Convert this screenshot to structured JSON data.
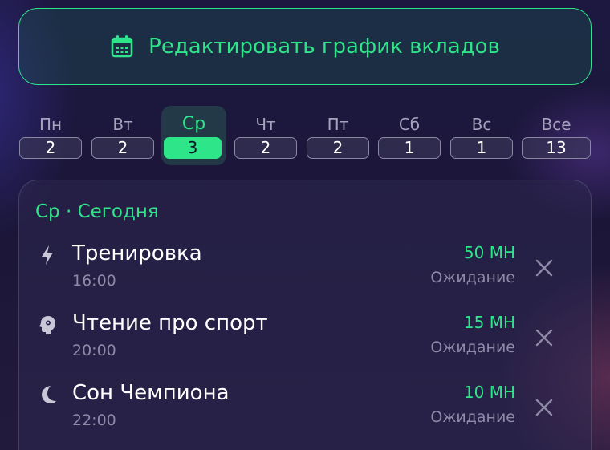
{
  "header": {
    "edit_button_label": "Редактировать график вкладов",
    "edit_button_icon": "calendar-icon"
  },
  "days": [
    {
      "name": "Пн",
      "count": "2",
      "active": false
    },
    {
      "name": "Вт",
      "count": "2",
      "active": false
    },
    {
      "name": "Ср",
      "count": "3",
      "active": true
    },
    {
      "name": "Чт",
      "count": "2",
      "active": false
    },
    {
      "name": "Пт",
      "count": "2",
      "active": false
    },
    {
      "name": "Сб",
      "count": "1",
      "active": false
    },
    {
      "name": "Вс",
      "count": "1",
      "active": false
    },
    {
      "name": "Все",
      "count": "13",
      "active": false
    }
  ],
  "panel": {
    "title": "Ср · Сегодня",
    "items": [
      {
        "name": "Тренировка",
        "time": "16:00",
        "amount": "50 МН",
        "status": "Ожидание",
        "icon": "lightning-icon"
      },
      {
        "name": "Чтение про спорт",
        "time": "20:00",
        "amount": "15 МН",
        "status": "Ожидание",
        "icon": "brain-icon"
      },
      {
        "name": "Сон Чемпиона",
        "time": "22:00",
        "amount": "10 МН",
        "status": "Ожидание",
        "icon": "moon-icon"
      }
    ]
  },
  "colors": {
    "accent": "#2ee58a",
    "background": "#1a1638",
    "muted_text": "#8f8aa8"
  }
}
